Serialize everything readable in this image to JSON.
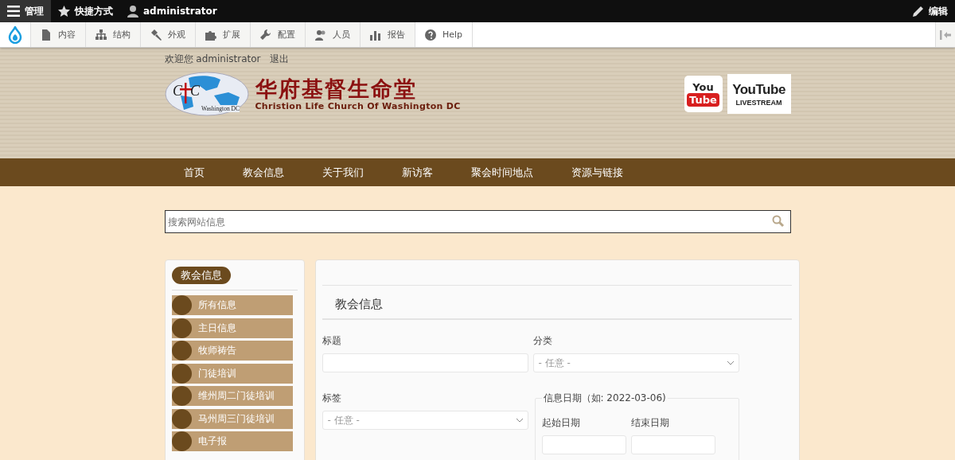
{
  "admin_bar": {
    "menu": "管理",
    "shortcuts": "快捷方式",
    "user": "administrator",
    "edit": "编辑"
  },
  "toolbar": {
    "items": [
      {
        "label": "内容",
        "kind": "page"
      },
      {
        "label": "结构",
        "kind": "tree"
      },
      {
        "label": "外观",
        "kind": "brush"
      },
      {
        "label": "扩展",
        "kind": "puzzle"
      },
      {
        "label": "配置",
        "kind": "wrench"
      },
      {
        "label": "人员",
        "kind": "people"
      },
      {
        "label": "报告",
        "kind": "chart"
      },
      {
        "label": "Help",
        "kind": "help"
      }
    ]
  },
  "header": {
    "welcome": "欢迎您 administrator",
    "logout": "退出",
    "logo": {
      "left": "C",
      "right": "C",
      "place": "Washington DC"
    },
    "site_title": "华府基督生命堂",
    "site_subtitle": "Christion Life Church Of Washington DC",
    "badges": [
      {
        "top": "You",
        "bottom": "Tube",
        "kind": "small"
      },
      {
        "top": "YouTube",
        "bottom": "LIVESTREAM",
        "kind": "live"
      }
    ]
  },
  "nav": [
    "首页",
    "教会信息",
    "关于我们",
    "新访客",
    "聚会时间地点",
    "资源与链接"
  ],
  "search": {
    "placeholder": "搜索网站信息"
  },
  "sidebar": {
    "title": "教会信息",
    "items": [
      "所有信息",
      "主日信息",
      "牧师祷告",
      "门徒培训",
      "维州周二门徒培训",
      "马州周三门徒培训",
      "电子报"
    ]
  },
  "content": {
    "title": "教会信息",
    "fields": [
      {
        "label": "标题",
        "kind": "text"
      },
      {
        "label": "分类",
        "kind": "select",
        "value": "- 任意 -"
      },
      {
        "label": "标签",
        "kind": "select",
        "value": "- 任意 -"
      }
    ],
    "date_group": {
      "legend": "信息日期（如: 2022-03-06)",
      "fields": [
        "起始日期",
        "结束日期"
      ]
    }
  }
}
